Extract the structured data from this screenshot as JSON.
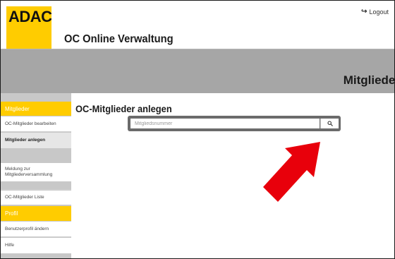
{
  "header": {
    "logo_text": "ADAC",
    "app_title": "OC Online Verwaltung",
    "logout_label": "Logout"
  },
  "banner": {
    "title": "Mitglieder"
  },
  "sidebar": {
    "sections": [
      {
        "label": "Mitglieder",
        "items": [
          {
            "label": "OC-Mitglieder bearbeiten",
            "active": false
          },
          {
            "label": "Mitglieder anlegen",
            "active": true
          },
          {
            "label": "Meldung zur Mitgliederversammlung",
            "active": false
          },
          {
            "label": "OC-Mitglieder Liste",
            "active": false
          }
        ]
      },
      {
        "label": "Profil",
        "items": [
          {
            "label": "Benutzerprofil ändern",
            "active": false
          },
          {
            "label": "Hilfe",
            "active": false
          }
        ]
      }
    ]
  },
  "main": {
    "page_title": "OC-Mitglieder anlegen",
    "search": {
      "placeholder": "Mitgliedsnummer",
      "value": ""
    }
  },
  "colors": {
    "accent": "#ffcc00",
    "banner": "#a6a6a6",
    "arrow": "#e8000b"
  },
  "icons": {
    "logout": "logout-icon",
    "search": "search-icon",
    "annotation": "red-arrow-icon"
  }
}
